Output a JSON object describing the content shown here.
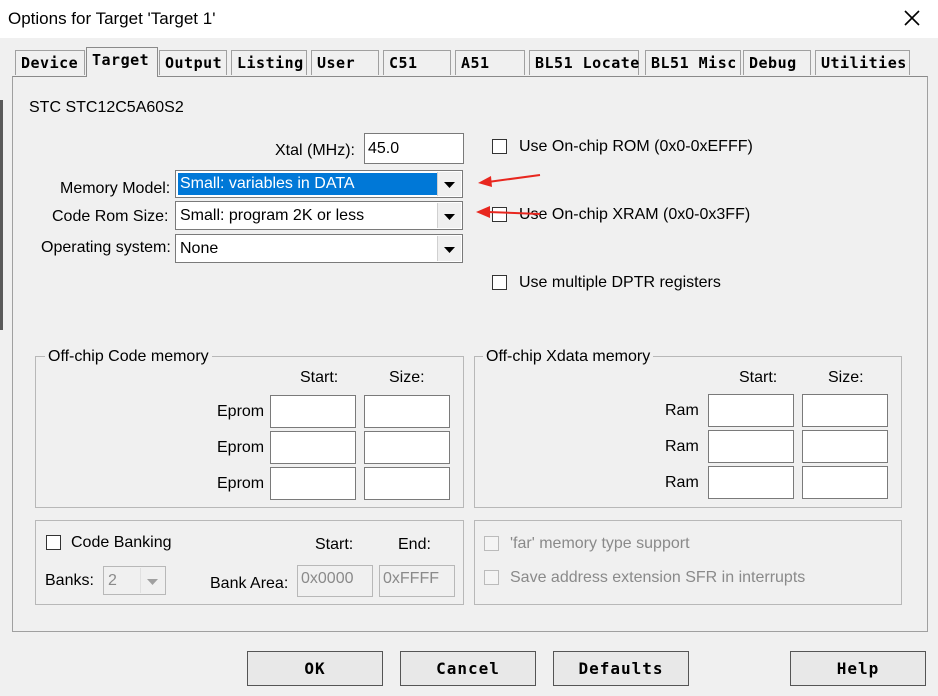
{
  "window": {
    "title": "Options for Target 'Target 1'"
  },
  "tabs": [
    "Device",
    "Target",
    "Output",
    "Listing",
    "User",
    "C51",
    "A51",
    "BL51 Locate",
    "BL51 Misc",
    "Debug",
    "Utilities"
  ],
  "active_tab": "Target",
  "device_name": "STC STC12C5A60S2",
  "xtal": {
    "label": "Xtal (MHz):",
    "value": "45.0"
  },
  "memory_model": {
    "label": "Memory Model:",
    "value": "Small: variables in DATA"
  },
  "code_rom_size": {
    "label": "Code Rom Size:",
    "value": "Small: program 2K or less"
  },
  "operating_system": {
    "label": "Operating system:",
    "value": "None"
  },
  "options": {
    "onchip_rom": "Use On-chip ROM (0x0-0xEFFF)",
    "onchip_xram": "Use On-chip XRAM (0x0-0x3FF)",
    "multiple_dptr": "Use multiple DPTR registers"
  },
  "offchip_code": {
    "title": "Off-chip Code memory",
    "start_header": "Start:",
    "size_header": "Size:",
    "rows": [
      {
        "label": "Eprom"
      },
      {
        "label": "Eprom"
      },
      {
        "label": "Eprom"
      }
    ]
  },
  "offchip_xdata": {
    "title": "Off-chip Xdata memory",
    "start_header": "Start:",
    "size_header": "Size:",
    "rows": [
      {
        "label": "Ram"
      },
      {
        "label": "Ram"
      },
      {
        "label": "Ram"
      }
    ]
  },
  "banking": {
    "code_banking": "Code Banking",
    "start_header": "Start:",
    "end_header": "End:",
    "banks_label": "Banks:",
    "banks_value": "2",
    "bank_area_label": "Bank Area:",
    "bank_area_start": "0x0000",
    "bank_area_end": "0xFFFF"
  },
  "far": {
    "far_memory": "'far' memory type support",
    "save_sfr": "Save address extension SFR in interrupts"
  },
  "buttons": {
    "ok": "OK",
    "cancel": "Cancel",
    "defaults": "Defaults",
    "help": "Help"
  },
  "colors": {
    "selection": "#0078d7",
    "annotation_arrow": "#e8271f"
  }
}
